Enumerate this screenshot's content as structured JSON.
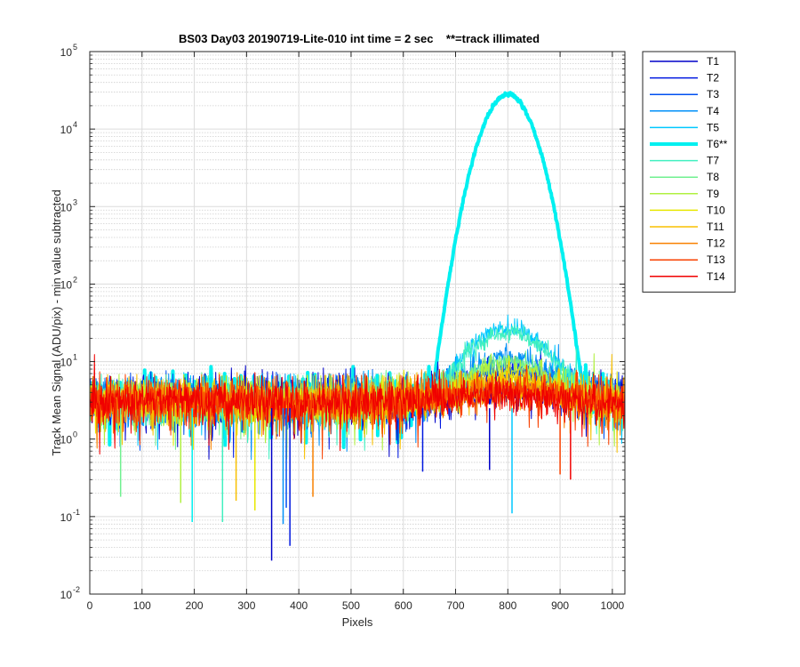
{
  "chart_data": {
    "type": "line",
    "title": "BS03 Day03 20190719-Lite-010 int time = 2 sec    **=track illimated",
    "xlabel": "Pixels",
    "ylabel": "Track Mean Signal (ADU/pix) - min value subtracted",
    "xlim": [
      0,
      1024
    ],
    "ylim": [
      0.01,
      100000
    ],
    "yscale": "log",
    "grid": true,
    "minor_grid": true,
    "legend_position": "outside-top-right",
    "x_ticks": [
      "0",
      "100",
      "200",
      "300",
      "400",
      "500",
      "600",
      "700",
      "800",
      "900",
      "1000"
    ],
    "y_ticks": [
      {
        "base": "10",
        "exp": "-2"
      },
      {
        "base": "10",
        "exp": "-1"
      },
      {
        "base": "10",
        "exp": "0"
      },
      {
        "base": "10",
        "exp": "1"
      },
      {
        "base": "10",
        "exp": "2"
      },
      {
        "base": "10",
        "exp": "3"
      },
      {
        "base": "10",
        "exp": "4"
      },
      {
        "base": "10",
        "exp": "5"
      }
    ],
    "series": [
      {
        "name": "T1",
        "color": "#0000c8",
        "baseline": 3.2,
        "peak": 1.2,
        "sigma": 80,
        "noise": 0.35,
        "width": 1.5
      },
      {
        "name": "T2",
        "color": "#0018e0",
        "baseline": 3.2,
        "peak": 3.5,
        "sigma": 75,
        "noise": 0.35,
        "width": 1.5
      },
      {
        "name": "T3",
        "color": "#0050f0",
        "baseline": 3.0,
        "peak": 5.0,
        "sigma": 72,
        "noise": 0.35,
        "width": 1.5
      },
      {
        "name": "T4",
        "color": "#0090f8",
        "baseline": 3.0,
        "peak": 8.0,
        "sigma": 70,
        "noise": 0.35,
        "width": 1.5
      },
      {
        "name": "T5",
        "color": "#00c8ff",
        "baseline": 3.0,
        "peak": 24.0,
        "sigma": 60,
        "noise": 0.33,
        "width": 1.5
      },
      {
        "name": "T6**",
        "color": "#00f0f0",
        "baseline": 3.5,
        "peak": 28000,
        "sigma": 34,
        "noise": 0.3,
        "width": 4
      },
      {
        "name": "T7",
        "color": "#40f0c0",
        "baseline": 3.0,
        "peak": 20.0,
        "sigma": 62,
        "noise": 0.33,
        "width": 1.5
      },
      {
        "name": "T8",
        "color": "#70f090",
        "baseline": 3.0,
        "peak": 7.0,
        "sigma": 66,
        "noise": 0.33,
        "width": 1.5
      },
      {
        "name": "T9",
        "color": "#b0f040",
        "baseline": 3.0,
        "peak": 5.0,
        "sigma": 68,
        "noise": 0.33,
        "width": 1.5
      },
      {
        "name": "T10",
        "color": "#e8e800",
        "baseline": 3.0,
        "peak": 3.0,
        "sigma": 70,
        "noise": 0.33,
        "width": 1.5
      },
      {
        "name": "T11",
        "color": "#f8c000",
        "baseline": 3.0,
        "peak": 2.0,
        "sigma": 72,
        "noise": 0.33,
        "width": 1.5
      },
      {
        "name": "T12",
        "color": "#f88000",
        "baseline": 3.0,
        "peak": 1.5,
        "sigma": 74,
        "noise": 0.33,
        "width": 1.5
      },
      {
        "name": "T13",
        "color": "#f84000",
        "baseline": 3.0,
        "peak": 1.0,
        "sigma": 76,
        "noise": 0.33,
        "width": 1.5
      },
      {
        "name": "T14",
        "color": "#f00000",
        "baseline": 3.0,
        "peak": 0.8,
        "sigma": 78,
        "noise": 0.33,
        "width": 1.5
      }
    ],
    "peak_x": 800,
    "low_spikes": [
      {
        "x": 348,
        "y": 0.027
      },
      {
        "x": 383,
        "y": 0.042
      },
      {
        "x": 376,
        "y": 0.13
      },
      {
        "x": 370,
        "y": 0.08
      },
      {
        "x": 808,
        "y": 0.11
      },
      {
        "x": 196,
        "y": 0.085
      },
      {
        "x": 254,
        "y": 0.085
      },
      {
        "x": 59,
        "y": 0.18
      },
      {
        "x": 174,
        "y": 0.15
      },
      {
        "x": 316,
        "y": 0.12
      },
      {
        "x": 280,
        "y": 0.16
      },
      {
        "x": 427,
        "y": 0.18
      },
      {
        "x": 900,
        "y": 0.35
      },
      {
        "x": 920,
        "y": 0.3
      },
      {
        "x": 765,
        "y": 0.4
      },
      {
        "x": 637,
        "y": 0.38
      }
    ]
  }
}
